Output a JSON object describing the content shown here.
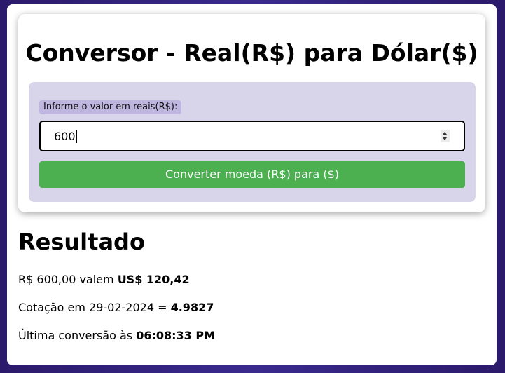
{
  "converter": {
    "title": "Conversor - Real(R$) para Dólar($)",
    "input_label": "Informe o valor em reais(R$):",
    "input_value": "600",
    "convert_button_label": "Converter moeda (R$) para ($)"
  },
  "result": {
    "heading": "Resultado",
    "amount_prefix": "R$ 600,00 valem ",
    "amount_value": "US$ 120,42",
    "rate_prefix": "Cotação em 29-02-2024 = ",
    "rate_value": "4.9827",
    "last_prefix": "Última conversão às ",
    "last_value": "06:08:33 PM"
  },
  "colors": {
    "accent_button": "#4caf50",
    "panel_background": "#d8d4ea",
    "label_background": "#bfb6e0",
    "page_background": "#2b1a6b"
  },
  "icons": {
    "spinner": "number-spinner-icon"
  }
}
